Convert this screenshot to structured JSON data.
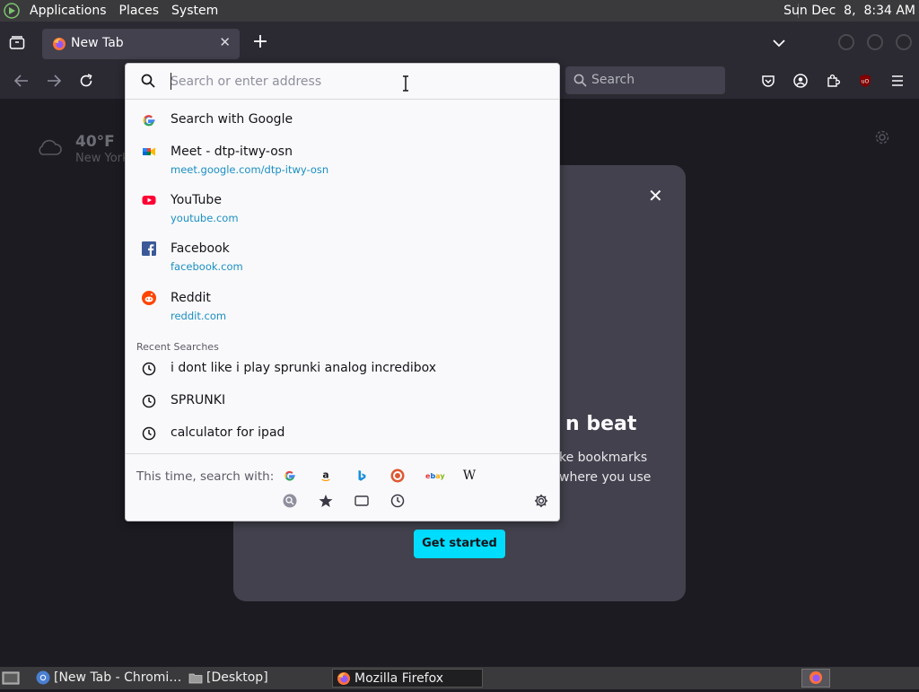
{
  "system_panel": {
    "menus": [
      "Applications",
      "Places",
      "System"
    ],
    "clock": "Sun Dec  8,  8:34 AM"
  },
  "tabs": [
    {
      "title": "New Tab",
      "active": true
    }
  ],
  "navbar": {
    "search_placeholder": "Search"
  },
  "newtab": {
    "weather_temp": "40°F",
    "weather_city": "New York",
    "modal_heading_visible": "n beat",
    "modal_body_visible": "ke bookmarks\nwhere you use",
    "cta_label": "Get started"
  },
  "urlbar": {
    "placeholder": "Search or enter address",
    "search_with": "Search with Google",
    "results": [
      {
        "title": "Meet - dtp-itwy-osn",
        "url": "meet.google.com/dtp-itwy-osn",
        "icon": "google-meet-icon"
      },
      {
        "title": "YouTube",
        "url": "youtube.com",
        "icon": "youtube-icon"
      },
      {
        "title": "Facebook",
        "url": "facebook.com",
        "icon": "facebook-icon"
      },
      {
        "title": "Reddit",
        "url": "reddit.com",
        "icon": "reddit-icon"
      }
    ],
    "recent_title": "Recent Searches",
    "recent": [
      "i dont like i play sprunki analog incredibox",
      "SPRUNKI",
      "calculator for ipad"
    ],
    "one_off_label": "This time, search with:",
    "engines": [
      "google",
      "amazon",
      "bing",
      "duckduckgo",
      "ebay",
      "wikipedia"
    ],
    "ebay_text": "ebay",
    "wiki_text": "W"
  },
  "taskbar": {
    "tasks": [
      "[New Tab - Chromi…",
      "[Desktop]",
      "Mozilla Firefox"
    ]
  },
  "colors": {
    "accent": "#00ddff",
    "toolbar": "#2b2a33",
    "content_bg": "#1c1b22",
    "modal_bg": "#42414d",
    "link": "#1a8fc2"
  }
}
